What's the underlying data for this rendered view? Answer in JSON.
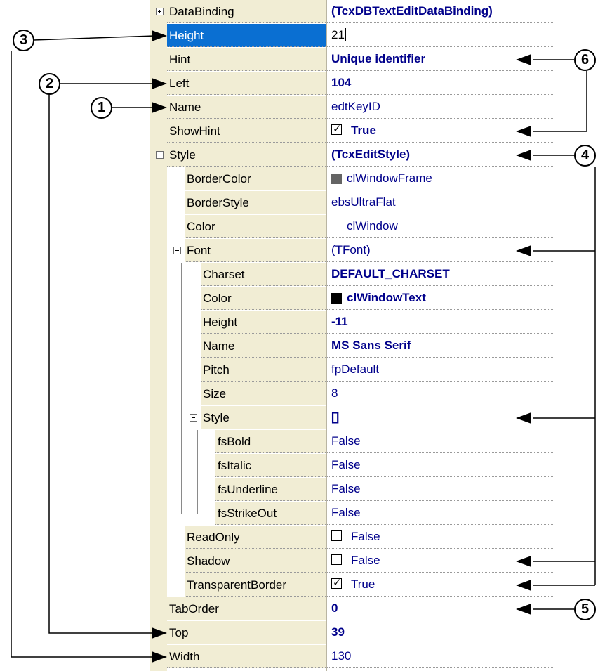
{
  "properties": [
    {
      "name": "DataBinding",
      "value": "(TcxDBTextEditDataBinding)",
      "bold": true,
      "indent": 0,
      "expander": "plus"
    },
    {
      "name": "Height",
      "value": "21",
      "bold": false,
      "indent": 0,
      "selected": true,
      "editing": true
    },
    {
      "name": "Hint",
      "value": "Unique identifier",
      "bold": true,
      "indent": 0
    },
    {
      "name": "Left",
      "value": "104",
      "bold": true,
      "indent": 0
    },
    {
      "name": "Name",
      "value": "edtKeyID",
      "bold": false,
      "indent": 0
    },
    {
      "name": "ShowHint",
      "value": "True",
      "bold": true,
      "indent": 0,
      "checkbox": true,
      "checked": true
    },
    {
      "name": "Style",
      "value": "(TcxEditStyle)",
      "bold": true,
      "indent": 0,
      "expander": "minus"
    },
    {
      "name": "BorderColor",
      "value": "clWindowFrame",
      "bold": false,
      "indent": 1,
      "swatch": "#646464"
    },
    {
      "name": "BorderStyle",
      "value": "ebsUltraFlat",
      "bold": false,
      "indent": 1
    },
    {
      "name": "Color",
      "value": "clWindow",
      "bold": false,
      "indent": 1,
      "swatch": "#ffffff"
    },
    {
      "name": "Font",
      "value": "(TFont)",
      "bold": false,
      "indent": 1,
      "expander": "minus"
    },
    {
      "name": "Charset",
      "value": "DEFAULT_CHARSET",
      "bold": true,
      "indent": 2
    },
    {
      "name": "Color",
      "value": "clWindowText",
      "bold": true,
      "indent": 2,
      "swatch": "#000000"
    },
    {
      "name": "Height",
      "value": "-11",
      "bold": true,
      "indent": 2
    },
    {
      "name": "Name",
      "value": "MS Sans Serif",
      "bold": true,
      "indent": 2
    },
    {
      "name": "Pitch",
      "value": "fpDefault",
      "bold": false,
      "indent": 2
    },
    {
      "name": "Size",
      "value": "8",
      "bold": false,
      "indent": 2
    },
    {
      "name": "Style",
      "value": "[]",
      "bold": true,
      "indent": 2,
      "expander": "minus"
    },
    {
      "name": "fsBold",
      "value": "False",
      "bold": false,
      "indent": 3
    },
    {
      "name": "fsItalic",
      "value": "False",
      "bold": false,
      "indent": 3
    },
    {
      "name": "fsUnderline",
      "value": "False",
      "bold": false,
      "indent": 3
    },
    {
      "name": "fsStrikeOut",
      "value": "False",
      "bold": false,
      "indent": 3
    },
    {
      "name": "ReadOnly",
      "value": "False",
      "bold": false,
      "indent": 1,
      "checkbox": true,
      "checked": false
    },
    {
      "name": "Shadow",
      "value": "False",
      "bold": false,
      "indent": 1,
      "checkbox": true,
      "checked": false
    },
    {
      "name": "TransparentBorder",
      "value": "True",
      "bold": false,
      "indent": 1,
      "checkbox": true,
      "checked": true
    },
    {
      "name": "TabOrder",
      "value": "0",
      "bold": true,
      "indent": 0
    },
    {
      "name": "Top",
      "value": "39",
      "bold": true,
      "indent": 0
    },
    {
      "name": "Width",
      "value": "130",
      "bold": false,
      "indent": 0
    }
  ],
  "callouts": [
    "1",
    "2",
    "3",
    "4",
    "5",
    "6"
  ],
  "colors": {
    "accent": "#0a6fd2",
    "name_column_bg": "#f1edd4",
    "value_text": "#00008b"
  }
}
